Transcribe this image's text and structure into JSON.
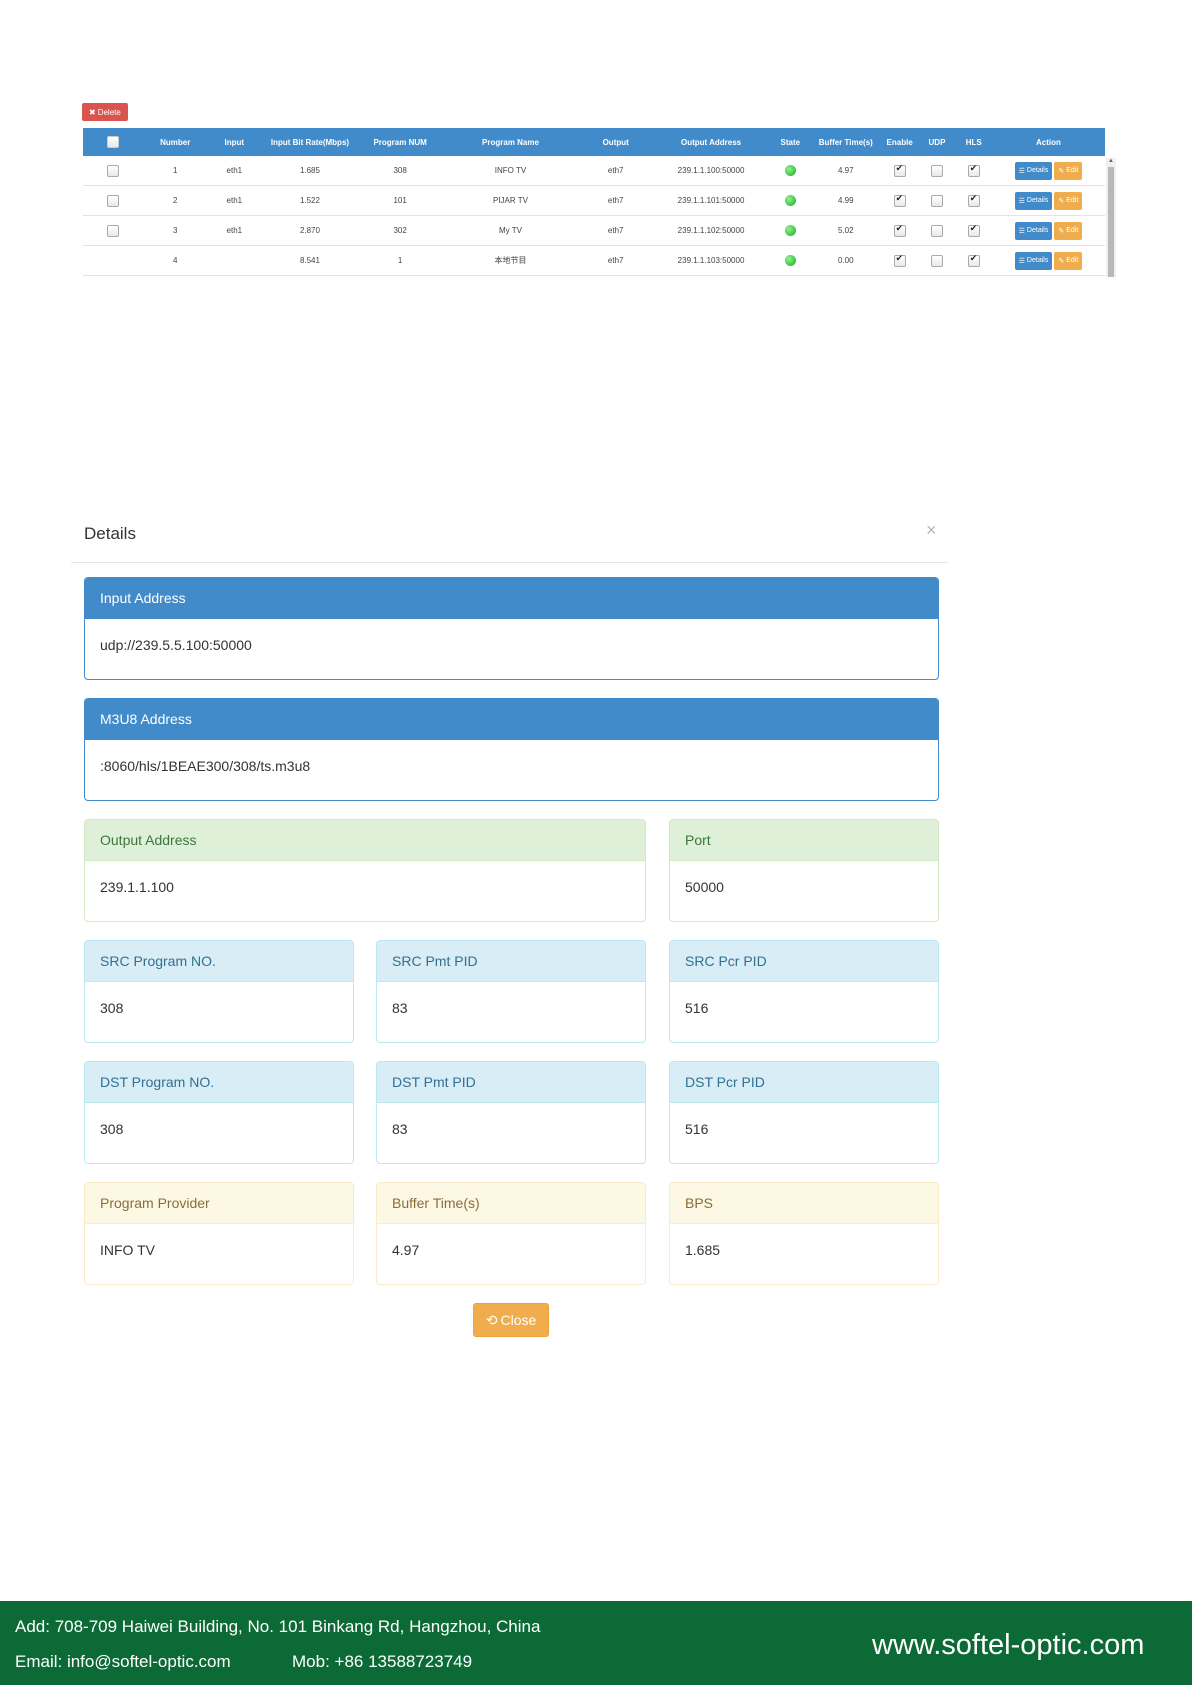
{
  "toolbar": {
    "delete_label": "Delete"
  },
  "table": {
    "headers": [
      "",
      "Number",
      "Input",
      "Input Bit Rate(Mbps)",
      "Program NUM",
      "Program Name",
      "Output",
      "Output Address",
      "State",
      "Buffer Time(s)",
      "Enable",
      "UDP",
      "HLS",
      "Action"
    ],
    "rows": [
      {
        "checkbox": true,
        "number": "1",
        "input": "eth1",
        "bitrate": "1.685",
        "program_num": "308",
        "program_name": "INFO TV",
        "output": "eth7",
        "output_address": "239.1.1.100:50000",
        "state": "green",
        "buffer": "4.97",
        "enable": true,
        "udp": false,
        "hls": true
      },
      {
        "checkbox": true,
        "number": "2",
        "input": "eth1",
        "bitrate": "1.522",
        "program_num": "101",
        "program_name": "PIJAR TV",
        "output": "eth7",
        "output_address": "239.1.1.101:50000",
        "state": "green",
        "buffer": "4.99",
        "enable": true,
        "udp": false,
        "hls": true
      },
      {
        "checkbox": true,
        "number": "3",
        "input": "eth1",
        "bitrate": "2.870",
        "program_num": "302",
        "program_name": "My TV",
        "output": "eth7",
        "output_address": "239.1.1.102:50000",
        "state": "green",
        "buffer": "5.02",
        "enable": true,
        "udp": false,
        "hls": true
      },
      {
        "checkbox": false,
        "number": "4",
        "input": "",
        "bitrate": "8.541",
        "program_num": "1",
        "program_name": "本地节目",
        "output": "eth7",
        "output_address": "239.1.1.103:50000",
        "state": "green",
        "buffer": "0.00",
        "enable": true,
        "udp": false,
        "hls": true
      }
    ],
    "actions": {
      "details_label": "Details",
      "edit_label": "Edit"
    }
  },
  "modal": {
    "title": "Details",
    "close_symbol": "×",
    "input_address": {
      "label": "Input Address",
      "value": "udp://239.5.5.100:50000"
    },
    "m3u8_address": {
      "label": "M3U8 Address",
      "value": ":8060/hls/1BEAE300/308/ts.m3u8"
    },
    "output_address": {
      "label": "Output Address",
      "value": "239.1.1.100"
    },
    "port": {
      "label": "Port",
      "value": "50000"
    },
    "src_program_no": {
      "label": "SRC Program NO.",
      "value": "308"
    },
    "src_pmt_pid": {
      "label": "SRC Pmt PID",
      "value": "83"
    },
    "src_pcr_pid": {
      "label": "SRC Pcr PID",
      "value": "516"
    },
    "dst_program_no": {
      "label": "DST Program NO.",
      "value": "308"
    },
    "dst_pmt_pid": {
      "label": "DST Pmt PID",
      "value": "83"
    },
    "dst_pcr_pid": {
      "label": "DST Pcr PID",
      "value": "516"
    },
    "program_provider": {
      "label": "Program Provider",
      "value": "INFO TV"
    },
    "buffer_time": {
      "label": "Buffer Time(s)",
      "value": "4.97"
    },
    "bps": {
      "label": "BPS",
      "value": "1.685"
    },
    "close_label": "Close"
  },
  "footer": {
    "address": "Add: 708-709 Haiwei Building, No. 101 Binkang Rd, Hangzhou, China",
    "email": "Email: info@softel-optic.com",
    "mobile": "Mob: +86 13588723749",
    "website": "www.softel-optic.com"
  },
  "colors": {
    "primary": "#428bca",
    "danger": "#d9534f",
    "warning": "#f0ad4e",
    "footer_bg": "#0c6a37",
    "state_ok": "#22bb22"
  }
}
